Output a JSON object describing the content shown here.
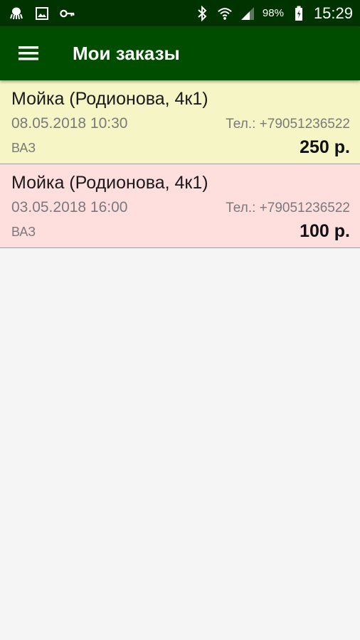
{
  "status_bar": {
    "icons_left": [
      "octopus-icon",
      "image-icon",
      "key-icon"
    ],
    "icons_right": [
      "bluetooth-icon",
      "wifi-icon",
      "signal-icon",
      "battery-icon"
    ],
    "battery_percent": "98%",
    "time": "15:29"
  },
  "app_bar": {
    "title": "Мои заказы",
    "menu_icon": "hamburger-menu-icon"
  },
  "colors": {
    "status_bar_bg": "#003300",
    "app_bar_bg": "#004d00",
    "order_pending_bg": "#f5f5c6",
    "order_cancelled_bg": "#ffdede"
  },
  "orders": [
    {
      "title": "Мойка (Родионова, 4к1)",
      "datetime": "08.05.2018 10:30",
      "phone": "Тел.: +79051236522",
      "car": "ВАЗ",
      "price": "250 р.",
      "bg": "#f5f5c6"
    },
    {
      "title": "Мойка (Родионова, 4к1)",
      "datetime": "03.05.2018 16:00",
      "phone": "Тел.: +79051236522",
      "car": "ВАЗ",
      "price": "100 р.",
      "bg": "#ffdede"
    }
  ]
}
